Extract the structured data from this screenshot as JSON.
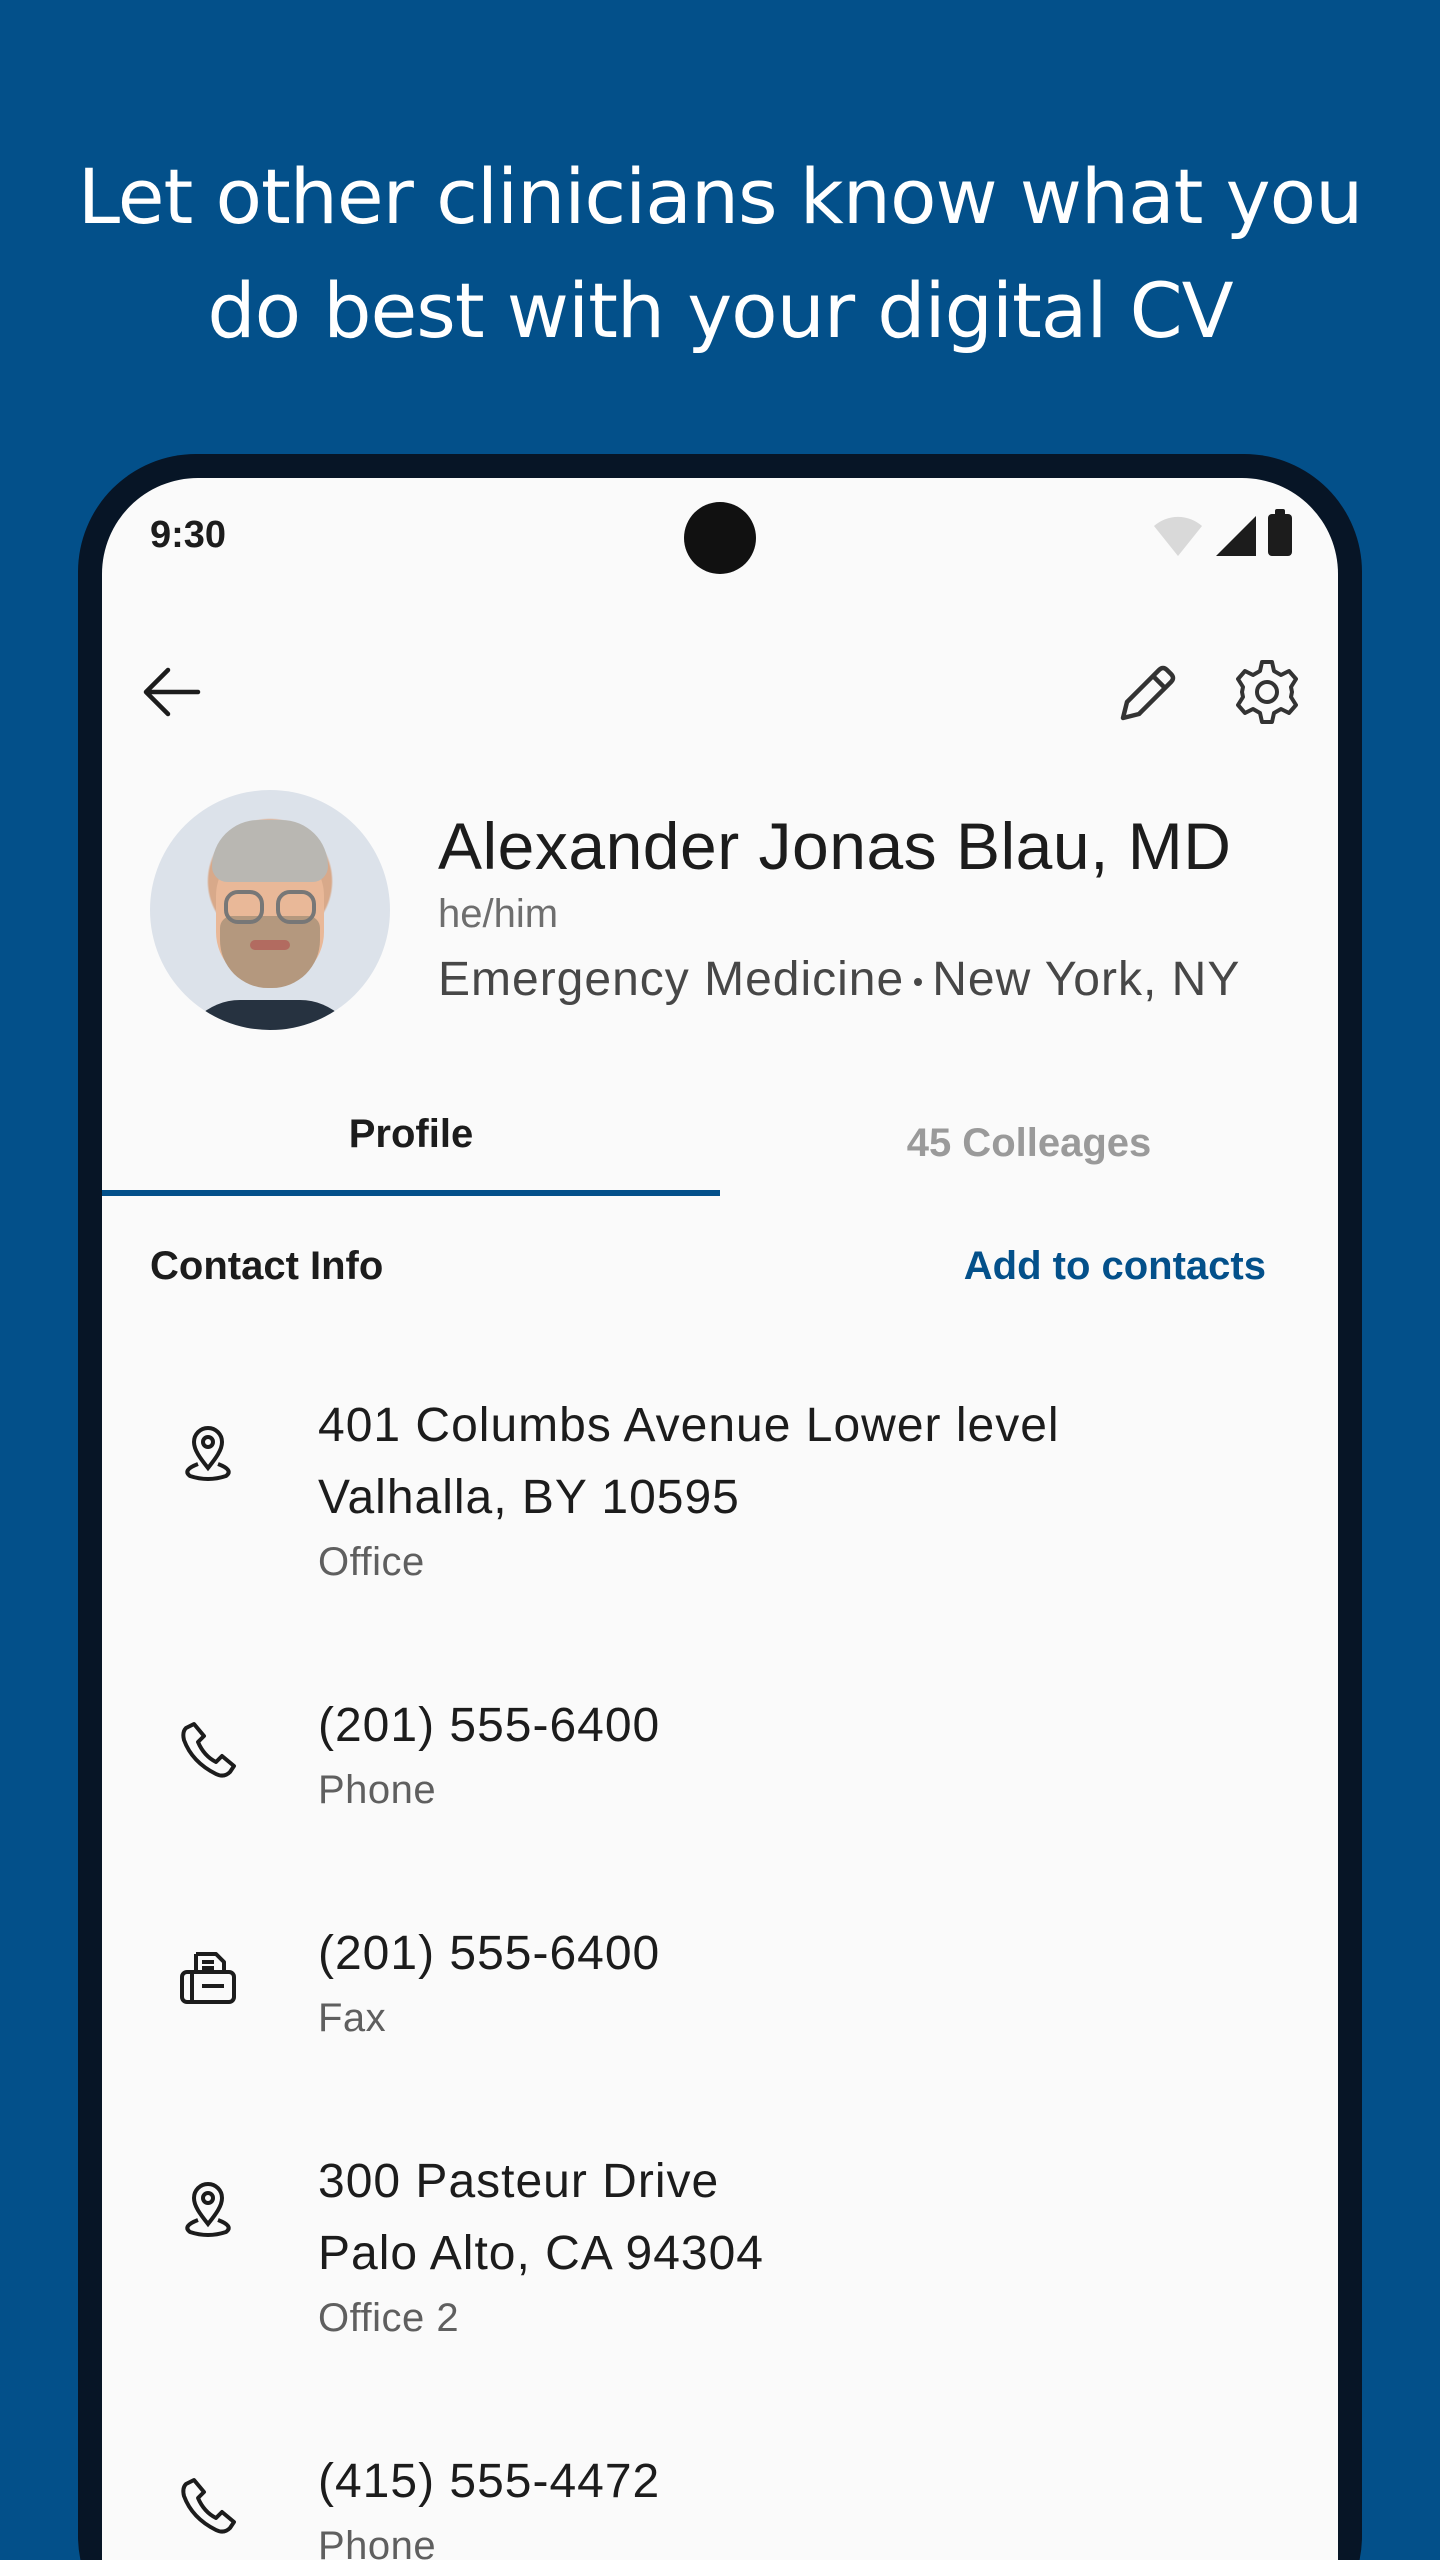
{
  "promo": {
    "headline_line1": "Let other clinicians know what you",
    "headline_line2": "do best with your digital CV"
  },
  "status_bar": {
    "time": "9:30",
    "icons": [
      "wifi-icon",
      "signal-icon",
      "battery-icon"
    ]
  },
  "toolbar": {
    "icons": [
      "back-arrow-icon",
      "edit-pencil-icon",
      "settings-gear-icon"
    ]
  },
  "profile": {
    "name": "Alexander Jonas Blau, MD",
    "pronouns": "he/him",
    "specialty": "Emergency Medicine",
    "location": "New York, NY"
  },
  "tabs": [
    {
      "label": "Profile",
      "selected": true
    },
    {
      "label": "45 Colleages",
      "selected": false
    }
  ],
  "contact_info": {
    "title": "Contact Info",
    "add_label": "Add to contacts",
    "items": [
      {
        "icon": "location-pin-icon",
        "lines": [
          "401 Columbs Avenue Lower level",
          "Valhalla, BY 10595"
        ],
        "label": "Office"
      },
      {
        "icon": "phone-icon",
        "lines": [
          "(201) 555-6400"
        ],
        "label": "Phone"
      },
      {
        "icon": "fax-icon",
        "lines": [
          "(201) 555-6400"
        ],
        "label": "Fax"
      },
      {
        "icon": "location-pin-icon",
        "lines": [
          "300 Pasteur Drive",
          "Palo Alto, CA 94304"
        ],
        "label": "Office 2"
      },
      {
        "icon": "phone-icon",
        "lines": [
          "(415) 555-4472"
        ],
        "label": "Phone"
      }
    ]
  },
  "colors": {
    "brand_blue": "#03508a",
    "screen_background": "#fafafa",
    "text_primary": "#1c1c1c",
    "text_secondary": "#5f5f5f"
  }
}
